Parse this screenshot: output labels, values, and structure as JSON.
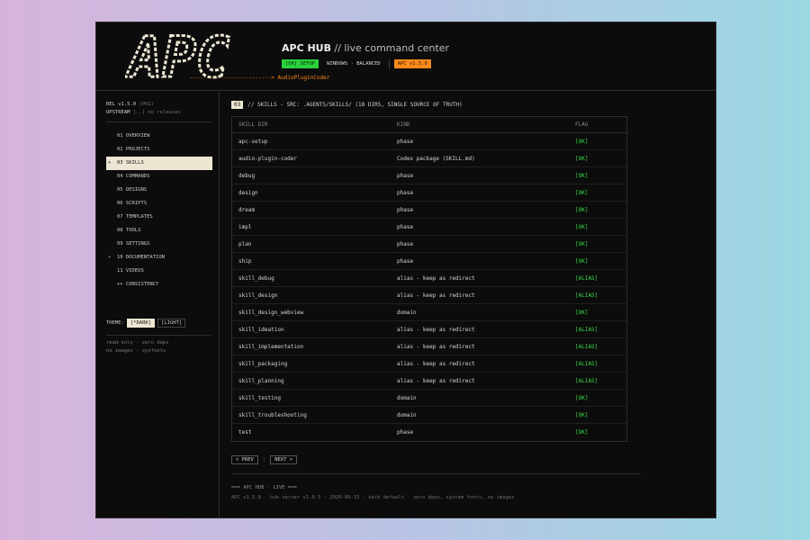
{
  "header": {
    "logo_text": "APC",
    "logo_subtitle": "-------------------------> AudioPluginCoder",
    "title": "APC HUB",
    "subtitle": " // live command center",
    "badges": {
      "setup": "[OK] SETUP",
      "platform": "WINDOWS · BALANCED",
      "version": "APC v1.5.0"
    },
    "colors": {
      "ok": "#2ad13c",
      "version": "#ff8a1c"
    }
  },
  "sidebar": {
    "release": "REL v1.5.0",
    "release_tag": "(PKG)",
    "upstream": "UPSTREAM",
    "upstream_status": "[..] no releases",
    "nav": [
      {
        "caret": "",
        "label": "01 OVERVIEW"
      },
      {
        "caret": "",
        "label": "02 PROJECTS"
      },
      {
        "caret": ">",
        "label": "03 SKILLS"
      },
      {
        "caret": "",
        "label": "04 COMMANDS"
      },
      {
        "caret": "",
        "label": "05 DESIGNS"
      },
      {
        "caret": "",
        "label": "06 SCRIPTS"
      },
      {
        "caret": "",
        "label": "07 TEMPLATES"
      },
      {
        "caret": "",
        "label": "08 TOOLS"
      },
      {
        "caret": "",
        "label": "09 SETTINGS"
      },
      {
        "caret": "+",
        "label": "10 DOCUMENTATION"
      },
      {
        "caret": "",
        "label": "11 VIDEOS"
      },
      {
        "caret": "",
        "label": "++ CONSISTENCY"
      }
    ],
    "theme_label": "THEME:",
    "theme_dark": "[*DARK]",
    "theme_light": "[LIGHT]",
    "note1": "read-only · zero deps",
    "note2": "no images · sysfonts"
  },
  "main": {
    "section_num": "03",
    "section_title": "// SKILLS - SRC: .AGENTS/SKILLS/ (18 DIRS, SINGLE SOURCE OF TRUTH)",
    "columns": [
      "SKILL DIR",
      "KIND",
      "FLAG"
    ],
    "rows": [
      [
        "apc-setup",
        "phase",
        "[OK]"
      ],
      [
        "audio-plugin-coder",
        "Codex package (SKILL.md)",
        "[OK]"
      ],
      [
        "debug",
        "phase",
        "[OK]"
      ],
      [
        "design",
        "phase",
        "[OK]"
      ],
      [
        "dream",
        "phase",
        "[OK]"
      ],
      [
        "impl",
        "phase",
        "[OK]"
      ],
      [
        "plan",
        "phase",
        "[OK]"
      ],
      [
        "ship",
        "phase",
        "[OK]"
      ],
      [
        "skill_debug",
        "alias - keep as redirect",
        "[ALIAS]"
      ],
      [
        "skill_design",
        "alias - keep as redirect",
        "[ALIAS]"
      ],
      [
        "skill_design_webview",
        "domain",
        "[OK]"
      ],
      [
        "skill_ideation",
        "alias - keep as redirect",
        "[ALIAS]"
      ],
      [
        "skill_implementation",
        "alias - keep as redirect",
        "[ALIAS]"
      ],
      [
        "skill_packaging",
        "alias - keep as redirect",
        "[ALIAS]"
      ],
      [
        "skill_planning",
        "alias - keep as redirect",
        "[ALIAS]"
      ],
      [
        "skill_testing",
        "domain",
        "[OK]"
      ],
      [
        "skill_troubleshooting",
        "domain",
        "[OK]"
      ],
      [
        "test",
        "phase",
        "[OK]"
      ]
    ],
    "prev": "< PREV",
    "next": "NEXT >",
    "pager_sep": "|",
    "footer_line1": "=== APC HUB · LIVE ===",
    "footer_line2": "APC v1.5.0 · hub server v1.0.3 · 2026-09-15 · dark default · zero deps, system fonts, no images"
  }
}
